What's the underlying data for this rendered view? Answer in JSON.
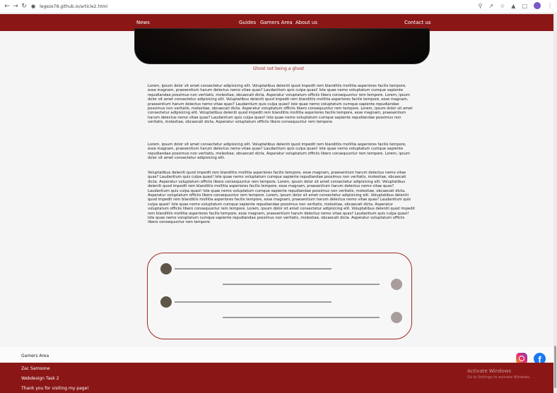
{
  "browser": {
    "url": "legeze78.github.io/article2.html",
    "icons": [
      "back-icon",
      "forward-icon",
      "reload-icon",
      "lock-icon",
      "zoom-icon",
      "share-icon",
      "star-icon",
      "extensions-icon",
      "sidebar-icon",
      "profile-avatar",
      "menu-icon"
    ]
  },
  "nav": {
    "news": "News",
    "guides": "Guides",
    "gamers_area": "Gamers Area",
    "about_us": "About us",
    "contact_us": "Contact us"
  },
  "hero": {
    "caption": "Ghost not being a ghost"
  },
  "article": {
    "paragraphs": [
      "Lorem, ipsum dolor sit amet consectetur adipisicing elit. Voluptatibus deleniti quod impedit rem blanditiis mollitia asperiores facilis tempore, esse magnam, praesentium harum delectus nemo vitae quas? Laudantium quis culpa quasi! Iste quae nemo voluptatum cumque sapiente repudiandae possimus non veritatis, molestiae, obcaecati dicta. Asperatur voluptatum officiis libero consequuntur rem tempore. Lorem, ipsum dolor sit amet consectetur adipisicing elit. Voluptatibus deleniti quod impedit rem blanditiis mollitia asperiores facilis tempore, esse magnam, praesentium harum delectus nemo vitae quas? Laudantium quis culpa quasi! Iste quae nemo voluptatum cumque sapiente repudiandae possimus non veritatis, molestiae, obcaecati dicta. Asperatur voluptatum officiis libero consequuntur rem tempore. Lorem, ipsum dolor sit amet consectetur adipisicing elit. Voluptatibus deleniti quod impedit rem blanditiis mollitia asperiores facilis tempore, esse magnam, praesentium harum delectus nemo vitae quas? Laudantium quis culpa quasi! Iste quae nemo voluptatum cumque sapiente repudiandae possimus non veritatis, molestiae, obcaecati dicta. Asperatur voluptatum officiis libero consequuntur rem tempore.",
      "Lorem, ipsum dolor sit amet consectetur adipisicing elit. Voluptatibus deleniti quod impedit rem blanditiis mollitia asperiores facilis tempore, esse magnam, praesentium harum delectus nemo vitae quas? Laudantium quis culpa quasi! Iste quae nemo voluptatum cumque sapiente repudiandae possimus non veritatis, molestiae, obcaecati dicta. Asperatur voluptatum officiis libero consequuntur rem tempore. Lorem, ipsum dolor sit amet consectetur adipisicing elit.",
      "Voluptatibus deleniti quod impedit rem blanditiis mollitia asperiores facilis tempore, esse magnam, praesentium harum delectus nemo vitae quas? Laudantium quis culpa quasi! Iste quae nemo voluptatum cumque sapiente repudiandae possimus non veritatis, molestiae, obcaecati dicta. Asperatur voluptatum officiis libero consequuntur rem tempore. Lorem, ipsum dolor sit amet consectetur adipisicing elit. Voluptatibus deleniti quod impedit rem blanditiis mollitia asperiores facilis tempore, esse magnam, praesentium harum delectus nemo vitae quas? Laudantium quis culpa quasi! Iste quae nemo voluptatum cumque sapiente repudiandae possimus non veritatis, molestiae, obcaecati dicta. Asperatur voluptatum officiis libero consequuntur rem tempore. Lorem, ipsum dolor sit amet consectetur adipisicing elit. Voluptatibus deleniti quod impedit rem blanditiis mollitia asperiores facilis tempore, esse magnam, praesentium harum delectus nemo vitae quas? Laudantium quis culpa quasi! Iste quae nemo voluptatum cumque sapiente repudiandae possimus non veritatis, molestiae, obcaecati dicta. Asperatur voluptatum officiis libero consequuntur rem tempore. Lorem, ipsum dolor sit amet consectetur adipisicing elit. Voluptatibus deleniti quod impedit rem blanditiis mollitia asperiores facilis tempore, esse magnam, praesentium harum delectus nemo vitae quas? Laudantium quis culpa quasi! Iste quae nemo voluptatum cumque sapiente repudiandae possimus non veritatis, molestiae, obcaecati dicta. Asperatur voluptatum officiis libero consequuntur rem tempore."
    ]
  },
  "footer": {
    "gamers_area": "Gamers Area",
    "author": "Zac Samsone",
    "task": "Webdesign Task 2",
    "thanks": "Thank you for visiting my page!",
    "social_icons": [
      "instagram-icon",
      "facebook-icon"
    ]
  },
  "os_overlay": {
    "activate_title": "Activate Windows",
    "activate_sub": "Go to Settings to activate Windows."
  },
  "colors": {
    "brand_red": "#8b1616",
    "caption_red": "#a12a2a",
    "dot_dark": "#5e5648",
    "dot_light": "#a89c9c"
  }
}
